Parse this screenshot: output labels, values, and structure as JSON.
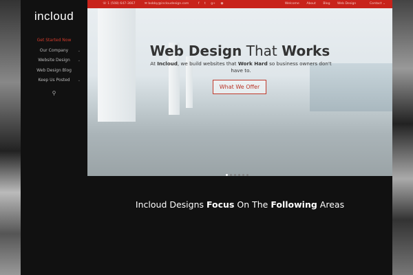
{
  "top_bar": {
    "phone": "1 (508) 647-3667",
    "email": "bobby@incloudesign.com",
    "social": [
      "facebook-icon",
      "twitter-icon",
      "google-plus-icon",
      "rss-icon"
    ],
    "links": [
      "Welcome",
      "About",
      "Blog",
      "Web Design",
      "Contact"
    ]
  },
  "sidebar": {
    "logo": "incloud",
    "items": [
      {
        "label": "Get Started Now"
      },
      {
        "label": "Our Company"
      },
      {
        "label": "Website Design"
      },
      {
        "label": "Web Design Blog"
      },
      {
        "label": "Keep Us Posted"
      }
    ]
  },
  "hero": {
    "title_1": "Web Design",
    "title_2": "That",
    "title_3": "Works",
    "sub_1": "At",
    "sub_2": "Incloud",
    "sub_3": ", we build websites that",
    "sub_4": "Work Hard",
    "sub_5": "so business owners don't have to.",
    "button": "What We Offer"
  },
  "section": {
    "t1": "Incloud Designs",
    "t2": "Focus",
    "t3": "On The",
    "t4": "Following",
    "t5": "Areas"
  },
  "colors": {
    "accent": "#c8231b"
  }
}
